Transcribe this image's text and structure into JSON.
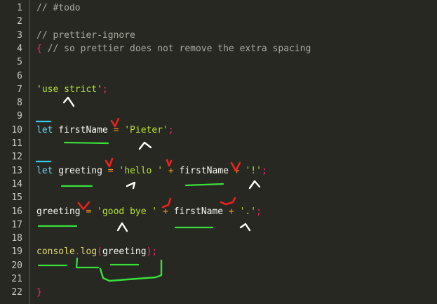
{
  "editor": {
    "lines": [
      {
        "number": "1",
        "tokens": [
          {
            "t": "// #todo",
            "c": "comment"
          }
        ]
      },
      {
        "number": "2",
        "tokens": []
      },
      {
        "number": "3",
        "tokens": [
          {
            "t": "// prettier-ignore",
            "c": "comment"
          }
        ]
      },
      {
        "number": "4",
        "tokens": [
          {
            "t": "{",
            "c": "punct"
          },
          {
            "t": " // so prettier does not remove the extra spacing",
            "c": "comment"
          }
        ]
      },
      {
        "number": "5",
        "tokens": []
      },
      {
        "number": "6",
        "tokens": []
      },
      {
        "number": "7",
        "tokens": [
          {
            "t": "'use strict'",
            "c": "string"
          },
          {
            "t": ";",
            "c": "punct"
          }
        ]
      },
      {
        "number": "8",
        "tokens": []
      },
      {
        "number": "9",
        "tokens": []
      },
      {
        "number": "10",
        "tokens": [
          {
            "t": "let",
            "c": "keyword"
          },
          {
            "t": " firstName ",
            "c": "ident"
          },
          {
            "t": "=",
            "c": "op"
          },
          {
            "t": " ",
            "c": "ident"
          },
          {
            "t": "'Pieter'",
            "c": "string"
          },
          {
            "t": ";",
            "c": "punct"
          }
        ]
      },
      {
        "number": "11",
        "tokens": []
      },
      {
        "number": "12",
        "tokens": []
      },
      {
        "number": "13",
        "tokens": [
          {
            "t": "let",
            "c": "keyword"
          },
          {
            "t": " greeting ",
            "c": "ident"
          },
          {
            "t": "=",
            "c": "op"
          },
          {
            "t": " ",
            "c": "ident"
          },
          {
            "t": "'hello '",
            "c": "string"
          },
          {
            "t": " ",
            "c": "ident"
          },
          {
            "t": "+",
            "c": "op"
          },
          {
            "t": " firstName ",
            "c": "ident"
          },
          {
            "t": "+",
            "c": "op"
          },
          {
            "t": " ",
            "c": "ident"
          },
          {
            "t": "'!'",
            "c": "string"
          },
          {
            "t": ";",
            "c": "punct"
          }
        ]
      },
      {
        "number": "14",
        "tokens": []
      },
      {
        "number": "15",
        "tokens": []
      },
      {
        "number": "16",
        "tokens": [
          {
            "t": "greeting ",
            "c": "ident"
          },
          {
            "t": "=",
            "c": "op"
          },
          {
            "t": " ",
            "c": "ident"
          },
          {
            "t": "'good bye '",
            "c": "string"
          },
          {
            "t": " ",
            "c": "ident"
          },
          {
            "t": "+",
            "c": "op"
          },
          {
            "t": " firstName ",
            "c": "ident"
          },
          {
            "t": "+",
            "c": "op"
          },
          {
            "t": " ",
            "c": "ident"
          },
          {
            "t": "'.'",
            "c": "string"
          },
          {
            "t": ";",
            "c": "punct"
          }
        ]
      },
      {
        "number": "17",
        "tokens": []
      },
      {
        "number": "18",
        "tokens": []
      },
      {
        "number": "19",
        "tokens": [
          {
            "t": "console",
            "c": "func"
          },
          {
            "t": ".",
            "c": "punct"
          },
          {
            "t": "log",
            "c": "func"
          },
          {
            "t": "(",
            "c": "punct"
          },
          {
            "t": "greeting",
            "c": "ident"
          },
          {
            "t": ")",
            "c": "punct"
          },
          {
            "t": ";",
            "c": "punct"
          }
        ]
      },
      {
        "number": "20",
        "tokens": []
      },
      {
        "number": "21",
        "tokens": []
      },
      {
        "number": "22",
        "tokens": [
          {
            "t": "}",
            "c": "punct"
          }
        ]
      }
    ]
  },
  "colors": {
    "background": "#272822",
    "comment": "#a9a99f",
    "string": "#b5e22c",
    "keyword": "#67d8ef",
    "func": "#e6db74",
    "op": "#fd971f",
    "punct": "#f92672",
    "annotation_red": "#e8231f",
    "annotation_green": "#39e03a",
    "annotation_white": "#ffffff",
    "annotation_cyan": "#3ccbf0"
  }
}
